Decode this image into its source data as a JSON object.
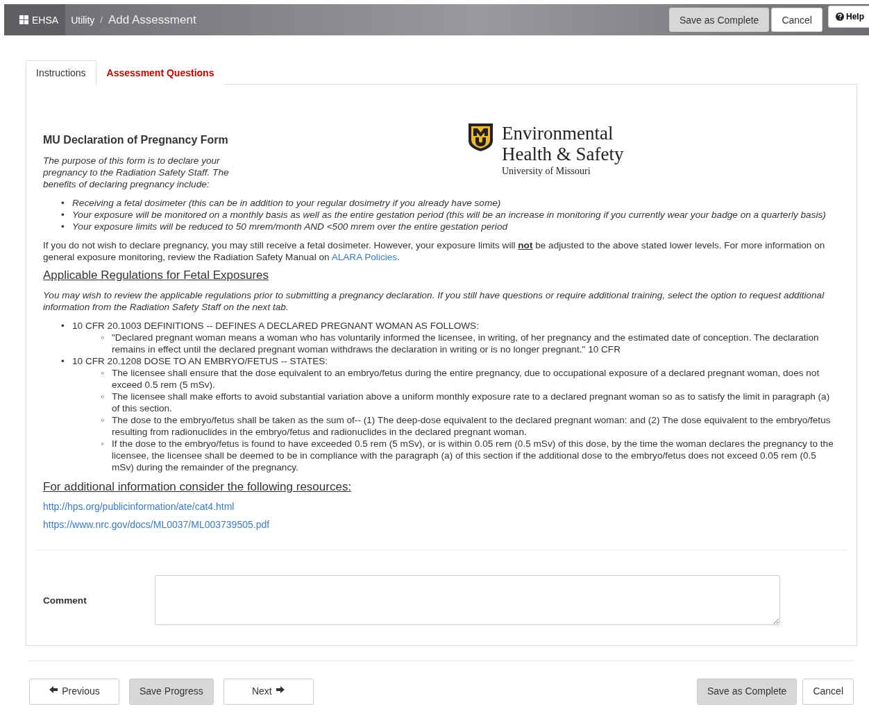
{
  "header": {
    "app": "EHSA",
    "breadcrumb": [
      {
        "label": "Utility"
      }
    ],
    "separator": "/",
    "title": "Add Assessment",
    "buttons": [
      {
        "label": "Save as Complete",
        "kind": "primary"
      },
      {
        "label": "Cancel",
        "kind": "default"
      }
    ],
    "help": "Help"
  },
  "tabs": [
    {
      "label": "Instructions",
      "selected": true
    },
    {
      "label": "Assessment Questions",
      "selected": false
    }
  ],
  "form": {
    "bullet": "•",
    "sub_bullet": "◦",
    "title": "MU Declaration of Pregnancy Form",
    "intro": "The purpose of this form is to declare your pregnancy to the Radiation Safety Staff. The benefits of declaring pregnancy include:",
    "logo": {
      "line_1": "Environmental",
      "line_2": "Health & Safety",
      "line_3": "University of Missouri"
    },
    "benefits": [
      "Receiving a fetal dosimeter (this can be in addition to your regular dosimetry if you already have some)",
      "Your exposure will be monitored on a monthly basis as well as the entire gestation period (this will be an increase in monitoring if you currently wear your badge on a quarterly basis)",
      "Your exposure limits will be reduced to 50 mrem/month AND <500 mrem over the entire gestation period"
    ],
    "notice": {
      "before": "If you do not wish to declare pregnancy, you may still receive a fetal dosimeter. However, your exposure limits will",
      "emphasis": "not",
      "after": "be adjusted to the above stated lower levels. For more information on general exposure monitoring, review the Radiation Safety Manual on",
      "link": "ALARA Policies",
      "end": "."
    },
    "regulations_heading": "Applicable Regulations for Fetal Exposures",
    "regulations_intro": "You may wish to review the applicable regulations prior to submitting a pregnancy declaration. If you still have questions or require additional training, select the option to request additional information from the Radiation Safety Staff on the next tab.",
    "regulations": [
      {
        "text": "10 CFR 20.1003 DEFINITIONS -- DEFINES A DECLARED PREGNANT WOMAN AS FOLLOWS:",
        "children": [
          "\"Declared pregnant woman means a woman who has voluntarily informed the licensee, in writing, of her pregnancy and the estimated date of conception. The declaration remains in effect until the declared pregnant woman withdraws the declaration in writing or is no longer pregnant.\" 10 CFR"
        ]
      },
      {
        "text": "10 CFR 20.1208 DOSE TO AN EMBRYO/FETUS -- STATES:",
        "children": [
          "The licensee shall ensure that the dose equivalent to an embryo/fetus during the entire pregnancy, due to occupational exposure of a declared pregnant woman, does not exceed 0.5 rem (5 mSv).",
          "The licensee shall make efforts to avoid substantial variation above a uniform monthly exposure rate to a declared pregnant woman so as to satisfy the limit in paragraph (a) of this section.",
          "The dose to the embryo/fetus shall be taken as the sum of-- (1) The deep-dose equivalent to the declared pregnant woman: and (2) The dose equivalent to the embryo/fetus resulting from radionuclides in the embryo/fetus and radionuclides in the declared pregnant woman.",
          "If the dose to the embryo/fetus is found to have exceeded 0.5 rem (5 mSv), or is within 0.05 rem (0.5 mSv) of this dose, by the time the woman declares the pregnancy to the licensee, the licensee shall be deemed to be in compliance with the paragraph (a) of this section if the additional dose to the embryo/fetus does not exceed 0.05 rem (0.5 mSv) during the remainder of the pregnancy."
        ]
      }
    ],
    "resources_heading": "For additional information consider the following resources:",
    "resource_links": [
      "http://hps.org/publicinformation/ate/cat4.html",
      "https://www.nrc.gov/docs/ML0037/ML003739505.pdf"
    ],
    "comment": {
      "label": "Comment"
    }
  },
  "footer": {
    "left": [
      {
        "label": "Previous",
        "kind": "back"
      },
      {
        "label": "Save Progress",
        "kind": "primary"
      },
      {
        "label": "Next",
        "kind": "forward"
      }
    ],
    "right": [
      {
        "label": "Save as Complete",
        "kind": "primary"
      },
      {
        "label": "Cancel",
        "kind": "default"
      }
    ]
  }
}
